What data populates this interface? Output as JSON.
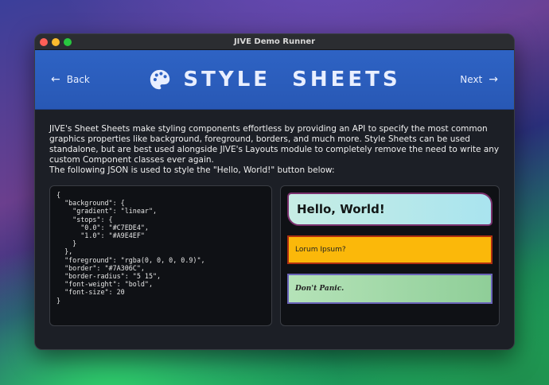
{
  "window": {
    "title": "JIVE Demo Runner"
  },
  "header": {
    "back_label": "Back",
    "next_label": "Next",
    "title": "STYLE SHEETS",
    "icon": "palette-icon"
  },
  "description": {
    "paragraph": "JIVE's Sheet Sheets make styling components effortless by providing an API to specify the most common graphics properties like background, foreground, borders, and much more. Style Sheets can be used standalone, but are best used alongside JIVE's Layouts module to completely remove the need to write any custom Component classes ever again.",
    "intro": "The following JSON is used to style the \"Hello, World!\" button below:"
  },
  "code": {
    "text": "{\n  \"background\": {\n    \"gradient\": \"linear\",\n    \"stops\": {\n      \"0.0\": \"#C7EDE4\",\n      \"1.0\": \"#A9E4EF\"\n    }\n  },\n  \"foreground\": \"rgba(0, 0, 0, 0.9)\",\n  \"border\": \"#7A306C\",\n  \"border-radius\": \"5 15\",\n  \"font-weight\": \"bold\",\n  \"font-size\": 20\n}"
  },
  "preview": {
    "hello_label": "Hello, World!",
    "lorem_label": "Lorum Ipsum?",
    "panic_label": "Don't Panic."
  },
  "colors": {
    "header_bg": "#2e63c4",
    "window_bg": "#1c1f26",
    "hello_start": "#C7EDE4",
    "hello_end": "#A9E4EF",
    "hello_border": "#7A306C",
    "lorem_bg": "#fbb80a",
    "lorem_border": "#b03010",
    "panic_border": "#6a64b8"
  }
}
